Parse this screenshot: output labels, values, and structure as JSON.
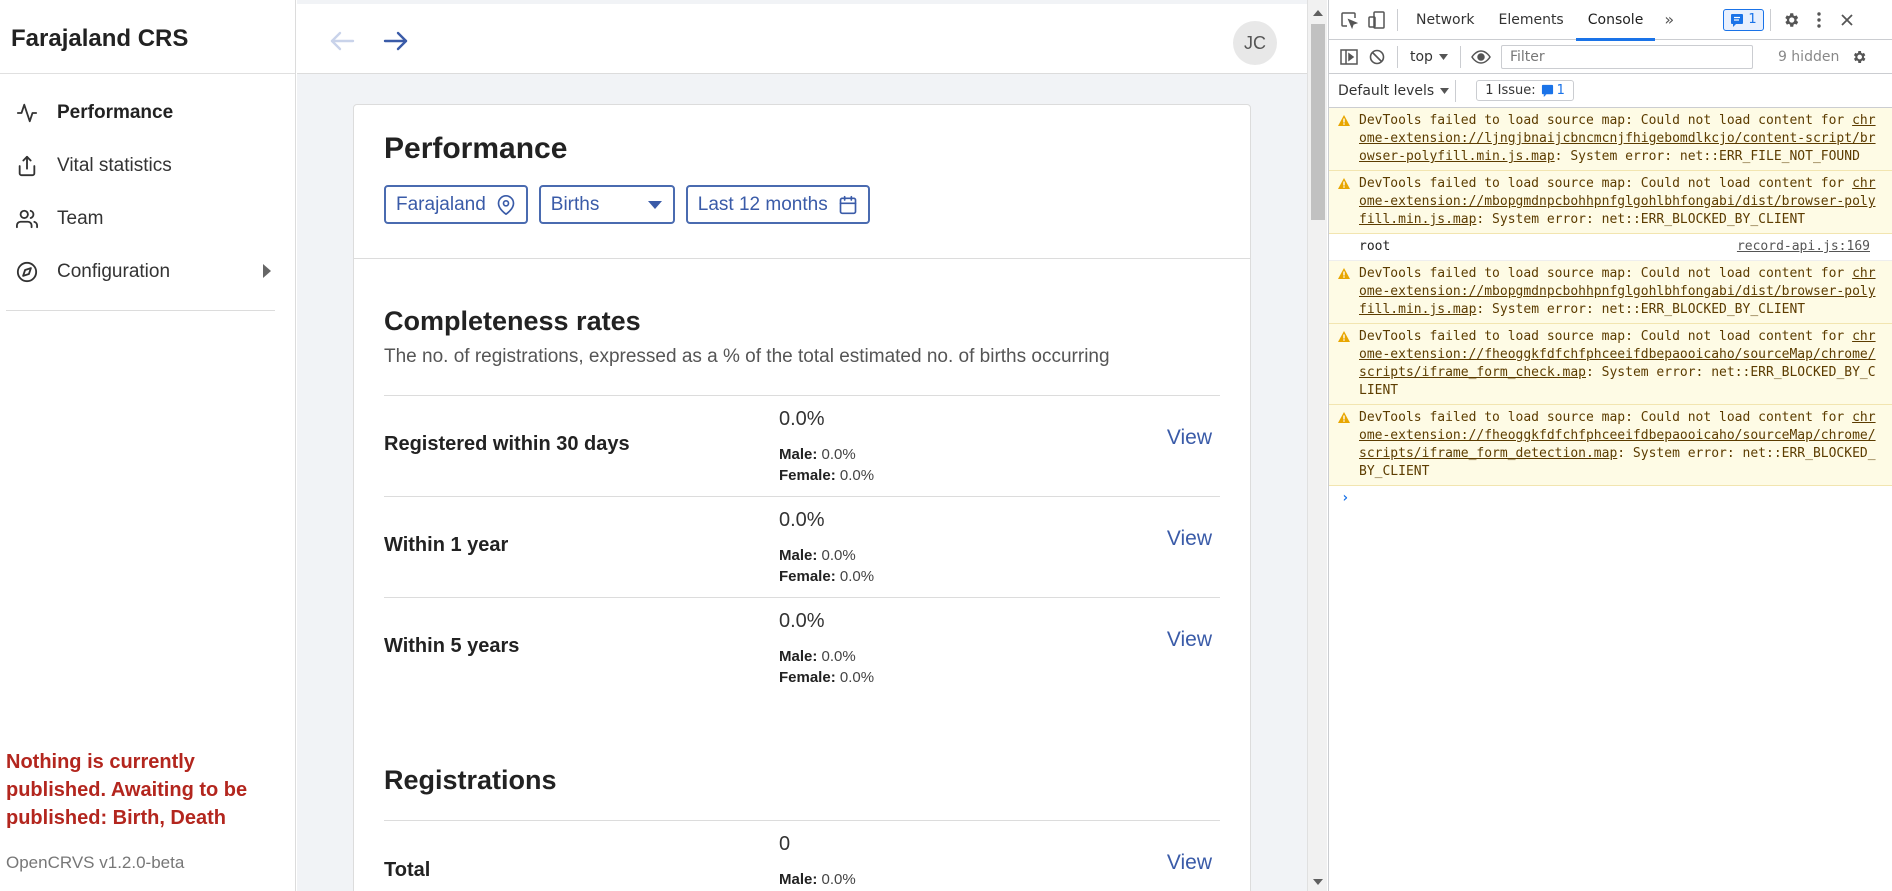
{
  "app": {
    "title": "Farajaland CRS",
    "nav": [
      {
        "label": "Performance",
        "icon": "activity-icon",
        "active": true
      },
      {
        "label": "Vital statistics",
        "icon": "export-icon",
        "active": false
      },
      {
        "label": "Team",
        "icon": "users-icon",
        "active": false
      },
      {
        "label": "Configuration",
        "icon": "compass-icon",
        "active": false
      }
    ],
    "unpublished_notice": "Nothing is currently published. Awaiting to be published: Birth, Death",
    "version": "OpenCRVS v1.2.0-beta",
    "user_initials": "JC"
  },
  "performance": {
    "title": "Performance",
    "filters": {
      "location": "Farajaland",
      "event": "Births",
      "period": "Last 12 months"
    },
    "completeness": {
      "title": "Completeness rates",
      "description": "The no. of registrations, expressed as a % of the total estimated no. of births occurring",
      "rows": [
        {
          "label": "Registered within 30 days",
          "value": "0.0%",
          "male_label": "Male:",
          "male": "0.0%",
          "female_label": "Female:",
          "female": "0.0%",
          "link": "View"
        },
        {
          "label": "Within 1 year",
          "value": "0.0%",
          "male_label": "Male:",
          "male": "0.0%",
          "female_label": "Female:",
          "female": "0.0%",
          "link": "View"
        },
        {
          "label": "Within 5 years",
          "value": "0.0%",
          "male_label": "Male:",
          "male": "0.0%",
          "female_label": "Female:",
          "female": "0.0%",
          "link": "View"
        }
      ]
    },
    "registrations": {
      "title": "Registrations",
      "rows": [
        {
          "label": "Total",
          "value": "0",
          "male_label": "Male:",
          "male": "0.0%",
          "link": "View"
        }
      ]
    }
  },
  "devtools": {
    "tabs": [
      "Network",
      "Elements",
      "Console"
    ],
    "active_tab": "Console",
    "issues_badge": "1",
    "context": "top",
    "filter_placeholder": "Filter",
    "hidden_count": "9 hidden",
    "levels": "Default levels",
    "issues_label": "1 Issue:",
    "issues_count": "1",
    "messages": [
      {
        "type": "warn",
        "pre": "DevTools failed to load source map: Could not load content for ",
        "link": "chrome-extension://ljngjbnaijcbncmcnjfhigebomdlkcjo/content-script/browser-polyfill.min.js.map",
        "post": ": System error: net::ERR_FILE_NOT_FOUND"
      },
      {
        "type": "warn",
        "pre": "DevTools failed to load source map: Could not load content for ",
        "link": "chrome-extension://mbopgmdnpcbohhpnfglgohlbhfongabi/dist/browser-polyfill.min.js.map",
        "post": ": System error: net::ERR_BLOCKED_BY_CLIENT"
      },
      {
        "type": "log",
        "text": "root",
        "source": "record-api.js:169"
      },
      {
        "type": "warn",
        "pre": "DevTools failed to load source map: Could not load content for ",
        "link": "chrome-extension://mbopgmdnpcbohhpnfglgohlbhfongabi/dist/browser-polyfill.min.js.map",
        "post": ": System error: net::ERR_BLOCKED_BY_CLIENT"
      },
      {
        "type": "warn",
        "pre": "DevTools failed to load source map: Could not load content for ",
        "link": "chrome-extension://fheoggkfdfchfphceeifdbepaooicaho/sourceMap/chrome/scripts/iframe_form_check.map",
        "post": ": System error: net::ERR_BLOCKED_BY_CLIENT"
      },
      {
        "type": "warn",
        "pre": "DevTools failed to load source map: Could not load content for ",
        "link": "chrome-extension://fheoggkfdfchfphceeifdbepaooicaho/sourceMap/chrome/scripts/iframe_form_detection.map",
        "post": ": System error: net::ERR_BLOCKED_BY_CLIENT"
      }
    ],
    "prompt": "›"
  },
  "colors": {
    "accent": "#3a5ba8",
    "warning_text": "#b3261e",
    "devtools_accent": "#1a73e8",
    "warning_bg": "#fefbe5"
  }
}
